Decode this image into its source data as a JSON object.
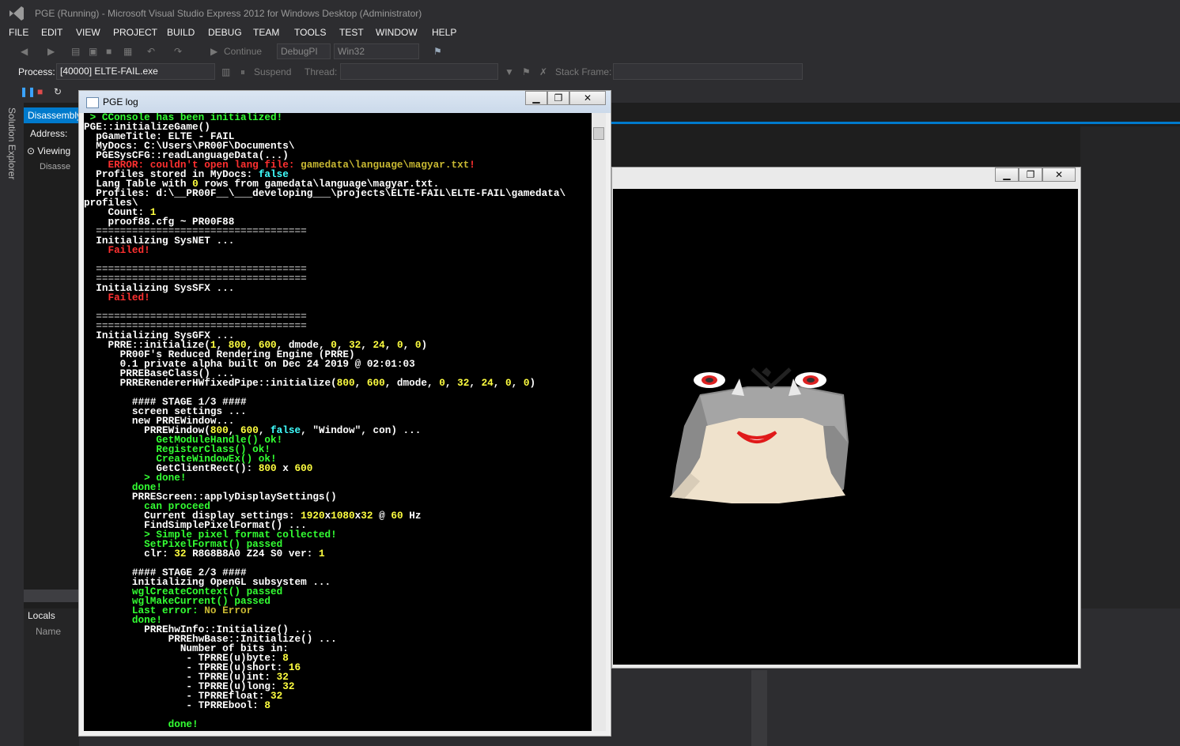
{
  "window": {
    "title": "PGE (Running) - Microsoft Visual Studio Express 2012 for Windows Desktop (Administrator)"
  },
  "menu": [
    "FILE",
    "EDIT",
    "VIEW",
    "PROJECT",
    "BUILD",
    "DEBUG",
    "TEAM",
    "TOOLS",
    "TEST",
    "WINDOW",
    "HELP"
  ],
  "toolbar": {
    "continue": "Continue",
    "config": "DebugPI",
    "platform": "Win32"
  },
  "debugbar": {
    "process_label": "Process:",
    "process_value": "[40000] ELTE-FAIL.exe",
    "suspend": "Suspend",
    "thread_label": "Thread:",
    "stack_label": "Stack Frame:"
  },
  "side": {
    "solution_explorer": "Solution Explorer",
    "disasm_tab": "Disassembly",
    "address_label": "Address:",
    "viewing": "Viewing",
    "disasm_text": "Disasse"
  },
  "locals": {
    "title": "Locals",
    "name_col": "Name"
  },
  "log_window": {
    "title": "PGE log",
    "min": "▁",
    "max": "❐",
    "close": "✕"
  },
  "game_window": {
    "min": "▁",
    "max": "❐",
    "close": "✕"
  },
  "console_lines": [
    [
      [
        "g",
        " > CConsole has been initialized!"
      ]
    ],
    [
      [
        "w",
        "PGE::initializeGame()"
      ]
    ],
    [
      [
        "w",
        "  pGameTitle: ELTE - FAIL"
      ]
    ],
    [
      [
        "w",
        "  MyDocs: C:\\Users\\PR00F\\Documents\\"
      ]
    ],
    [
      [
        "w",
        "  PGESysCFG::readLanguageData(...)"
      ]
    ],
    [
      [
        "r",
        "    ERROR: couldn't open lang file: "
      ],
      [
        "o",
        "gamedata\\language\\magyar.txt"
      ],
      [
        "r",
        "!"
      ]
    ],
    [
      [
        "w",
        "  Profiles stored in MyDocs: "
      ],
      [
        "c",
        "false"
      ]
    ],
    [
      [
        "w",
        "  Lang Table with "
      ],
      [
        "y",
        "0"
      ],
      [
        "w",
        " rows from gamedata\\language\\magyar.txt."
      ]
    ],
    [
      [
        "w",
        "  Profiles: d:\\__PR00F__\\___developing___\\projects\\ELTE-FAIL\\ELTE-FAIL\\gamedata\\"
      ]
    ],
    [
      [
        "w",
        "profiles\\"
      ]
    ],
    [
      [
        "w",
        "    Count: "
      ],
      [
        "y",
        "1"
      ]
    ],
    [
      [
        "w",
        "    proof88.cfg ~ PR00F88"
      ]
    ],
    [
      [
        "gr",
        "  ==================================="
      ]
    ],
    [
      [
        "w",
        "  Initializing SysNET ..."
      ]
    ],
    [
      [
        "r",
        "    Failed!"
      ]
    ],
    [
      [
        "w",
        ""
      ]
    ],
    [
      [
        "gr",
        "  ==================================="
      ]
    ],
    [
      [
        "gr",
        "  ==================================="
      ]
    ],
    [
      [
        "w",
        "  Initializing SysSFX ..."
      ]
    ],
    [
      [
        "r",
        "    Failed!"
      ]
    ],
    [
      [
        "w",
        ""
      ]
    ],
    [
      [
        "gr",
        "  ==================================="
      ]
    ],
    [
      [
        "gr",
        "  ==================================="
      ]
    ],
    [
      [
        "w",
        "  Initializing SysGFX ..."
      ]
    ],
    [
      [
        "w",
        "    PRRE::initialize("
      ],
      [
        "y",
        "1"
      ],
      [
        "w",
        ", "
      ],
      [
        "y",
        "800"
      ],
      [
        "w",
        ", "
      ],
      [
        "y",
        "600"
      ],
      [
        "w",
        ", dmode, "
      ],
      [
        "y",
        "0"
      ],
      [
        "w",
        ", "
      ],
      [
        "y",
        "32"
      ],
      [
        "w",
        ", "
      ],
      [
        "y",
        "24"
      ],
      [
        "w",
        ", "
      ],
      [
        "y",
        "0"
      ],
      [
        "w",
        ", "
      ],
      [
        "y",
        "0"
      ],
      [
        "w",
        ")"
      ]
    ],
    [
      [
        "w",
        "      PR00F's Reduced Rendering Engine (PRRE)"
      ]
    ],
    [
      [
        "w",
        "      0.1 private alpha built on Dec 24 2019 @ 02:01:03"
      ]
    ],
    [
      [
        "w",
        "      PRREBaseClass() ..."
      ]
    ],
    [
      [
        "w",
        "      PRRERendererHWfixedPipe::initialize("
      ],
      [
        "y",
        "800"
      ],
      [
        "w",
        ", "
      ],
      [
        "y",
        "600"
      ],
      [
        "w",
        ", dmode, "
      ],
      [
        "y",
        "0"
      ],
      [
        "w",
        ", "
      ],
      [
        "y",
        "32"
      ],
      [
        "w",
        ", "
      ],
      [
        "y",
        "24"
      ],
      [
        "w",
        ", "
      ],
      [
        "y",
        "0"
      ],
      [
        "w",
        ", "
      ],
      [
        "y",
        "0"
      ],
      [
        "w",
        ")"
      ]
    ],
    [
      [
        "w",
        ""
      ]
    ],
    [
      [
        "w",
        "        #### STAGE 1/3 ####"
      ]
    ],
    [
      [
        "w",
        "        screen settings ..."
      ]
    ],
    [
      [
        "w",
        "        new PRREWindow..."
      ]
    ],
    [
      [
        "w",
        "          PRREWindow("
      ],
      [
        "y",
        "800"
      ],
      [
        "w",
        ", "
      ],
      [
        "y",
        "600"
      ],
      [
        "w",
        ", "
      ],
      [
        "c",
        "false"
      ],
      [
        "w",
        ", \"Window\", con) ..."
      ]
    ],
    [
      [
        "g",
        "            GetModuleHandle() ok!"
      ]
    ],
    [
      [
        "g",
        "            RegisterClass() ok!"
      ]
    ],
    [
      [
        "g",
        "            CreateWindowEx() ok!"
      ]
    ],
    [
      [
        "w",
        "            GetClientRect(): "
      ],
      [
        "y",
        "800"
      ],
      [
        "w",
        " x "
      ],
      [
        "y",
        "600"
      ]
    ],
    [
      [
        "g",
        "          > done!"
      ]
    ],
    [
      [
        "g",
        "        done!"
      ]
    ],
    [
      [
        "w",
        "        PRREScreen::applyDisplaySettings()"
      ]
    ],
    [
      [
        "g",
        "          can proceed"
      ]
    ],
    [
      [
        "w",
        "          Current display settings: "
      ],
      [
        "y",
        "1920"
      ],
      [
        "w",
        "x"
      ],
      [
        "y",
        "1080"
      ],
      [
        "w",
        "x"
      ],
      [
        "y",
        "32"
      ],
      [
        "w",
        " @ "
      ],
      [
        "y",
        "60"
      ],
      [
        "w",
        " Hz"
      ]
    ],
    [
      [
        "w",
        "          FindSimplePixelFormat() ..."
      ]
    ],
    [
      [
        "g",
        "          > Simple pixel format collected!"
      ]
    ],
    [
      [
        "g",
        "          SetPixelFormat() passed"
      ]
    ],
    [
      [
        "w",
        "          clr: "
      ],
      [
        "y",
        "32"
      ],
      [
        "w",
        " R8G8B8A0 Z24 S0 ver: "
      ],
      [
        "y",
        "1"
      ]
    ],
    [
      [
        "w",
        ""
      ]
    ],
    [
      [
        "w",
        "        #### STAGE 2/3 ####"
      ]
    ],
    [
      [
        "w",
        "        initializing OpenGL subsystem ..."
      ]
    ],
    [
      [
        "g",
        "        wglCreateContext() passed"
      ]
    ],
    [
      [
        "g",
        "        wglMakeCurrent() passed"
      ]
    ],
    [
      [
        "g",
        "        Last error: "
      ],
      [
        "o",
        "No Error"
      ]
    ],
    [
      [
        "g",
        "        done!"
      ]
    ],
    [
      [
        "w",
        "          PRREhwInfo::Initialize() ..."
      ]
    ],
    [
      [
        "w",
        "              PRREhwBase::Initialize() ..."
      ]
    ],
    [
      [
        "w",
        "                Number of bits in:"
      ]
    ],
    [
      [
        "w",
        "                 - TPRRE(u)byte: "
      ],
      [
        "y",
        "8"
      ]
    ],
    [
      [
        "w",
        "                 - TPRRE(u)short: "
      ],
      [
        "y",
        "16"
      ]
    ],
    [
      [
        "w",
        "                 - TPRRE(u)int: "
      ],
      [
        "y",
        "32"
      ]
    ],
    [
      [
        "w",
        "                 - TPRRE(u)long: "
      ],
      [
        "y",
        "32"
      ]
    ],
    [
      [
        "w",
        "                 - TPRREfloat: "
      ],
      [
        "y",
        "32"
      ]
    ],
    [
      [
        "w",
        "                 - TPRREbool: "
      ],
      [
        "y",
        "8"
      ]
    ],
    [
      [
        "w",
        ""
      ]
    ],
    [
      [
        "g",
        "              done!"
      ]
    ]
  ]
}
